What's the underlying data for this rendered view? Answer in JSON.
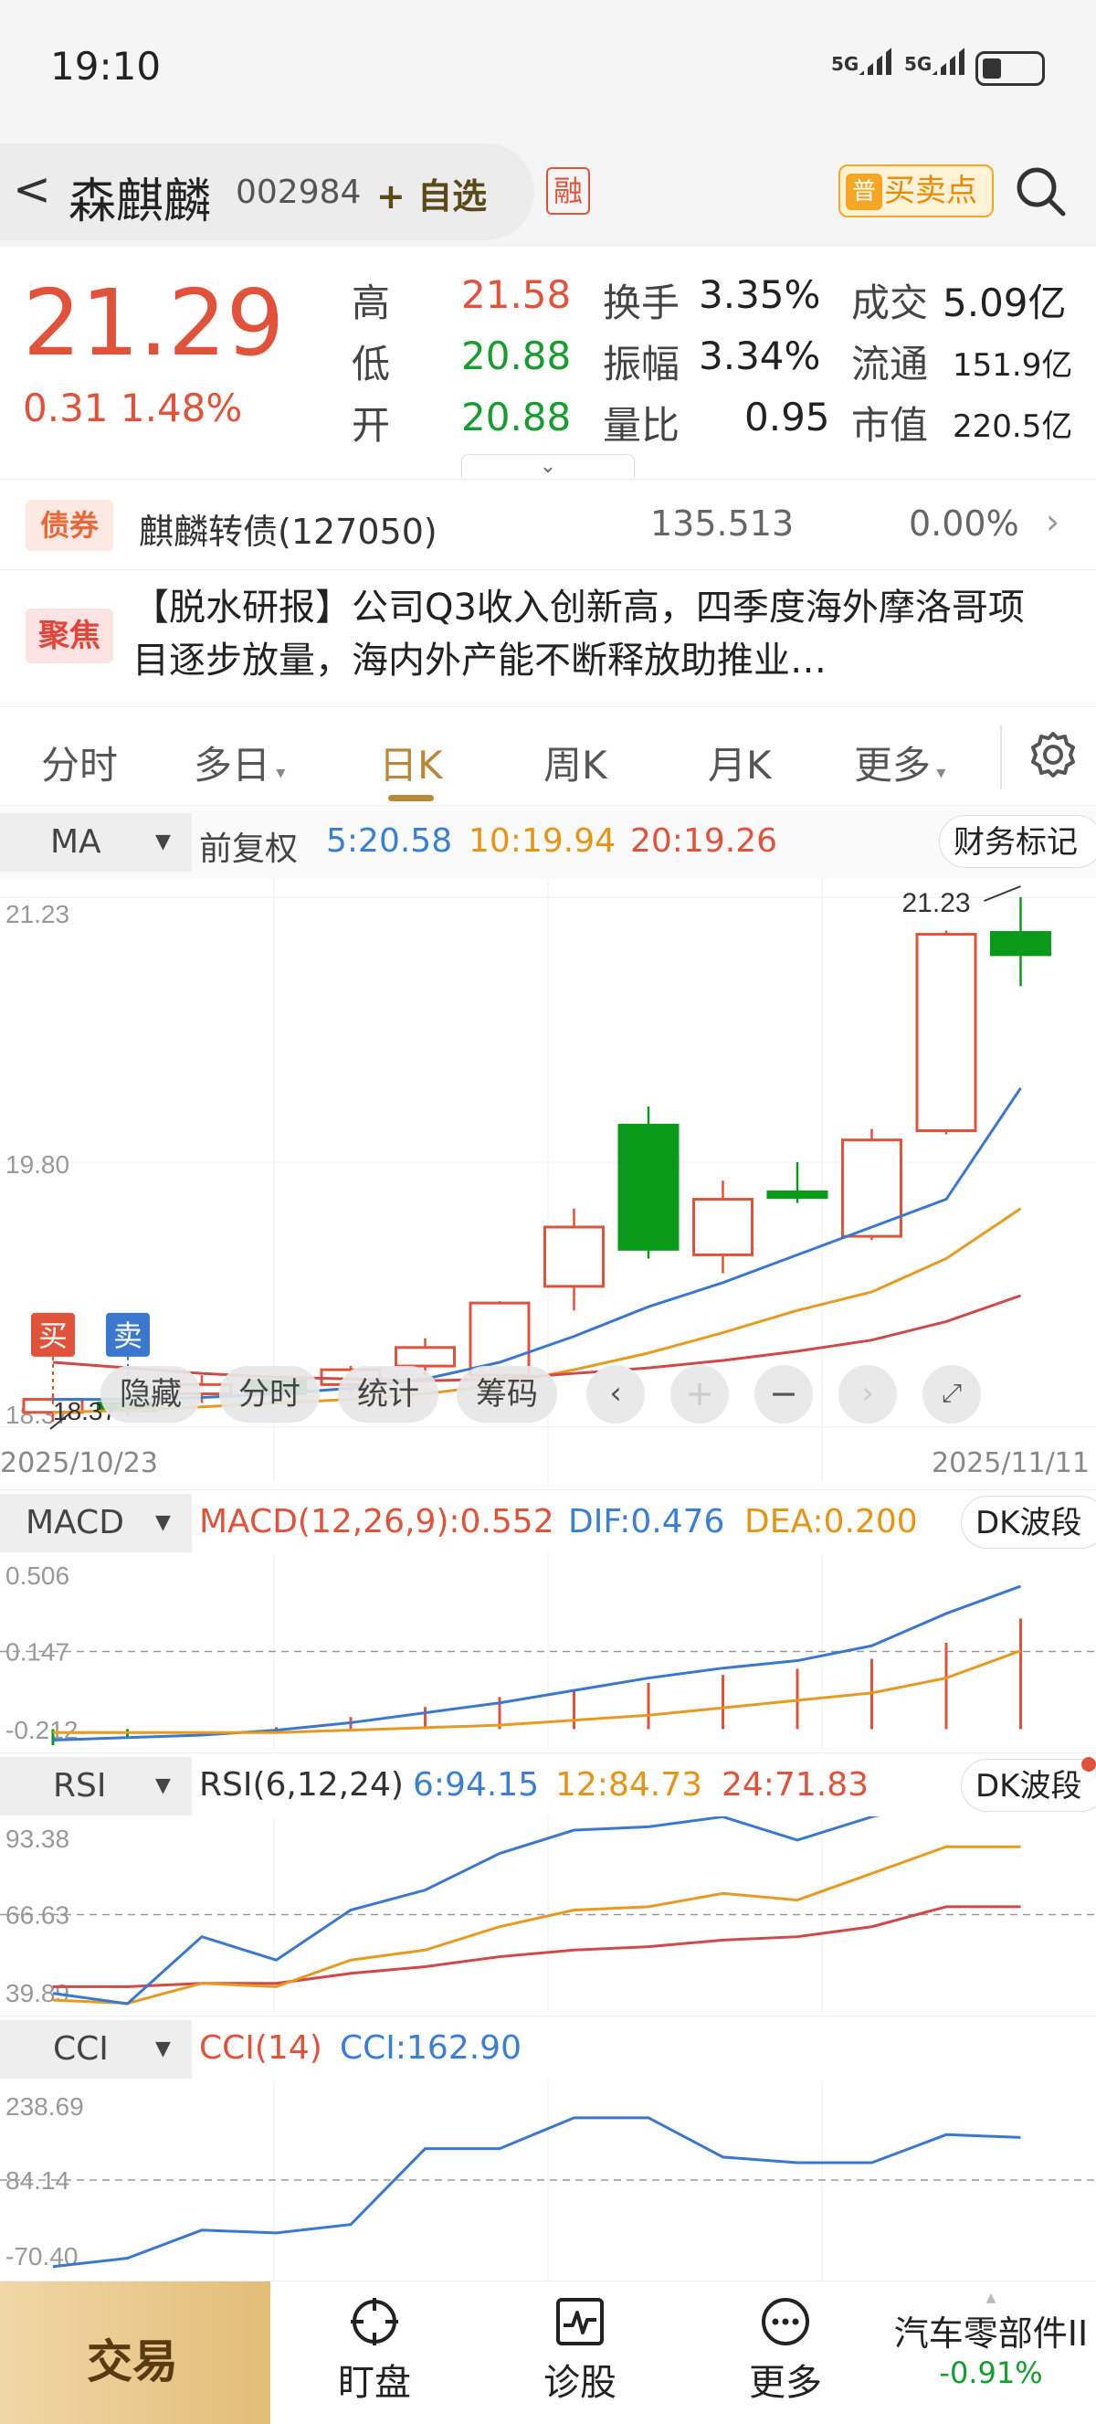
{
  "status": {
    "time": "19:10",
    "signal1": "5G",
    "signal2": "5G"
  },
  "header": {
    "back": "<",
    "name": "森麒麟",
    "code": "002984",
    "add_watch": "自选",
    "margin_badge": "融",
    "buy_sell_points": "买卖点",
    "pu_badge": "普"
  },
  "quote": {
    "price": "21.29",
    "change": "0.31",
    "change_pct": "1.48%",
    "high_label": "高",
    "high": "21.58",
    "low_label": "低",
    "low": "20.88",
    "open_label": "开",
    "open": "20.88",
    "turnover_label": "换手",
    "turnover": "3.35%",
    "amplitude_label": "振幅",
    "amplitude": "3.34%",
    "vol_ratio_label": "量比",
    "vol_ratio": "0.95",
    "deal_label": "成交",
    "deal": "5.09亿",
    "float_label": "流通",
    "float": "151.9亿",
    "mcap_label": "市值",
    "mcap": "220.5亿"
  },
  "bond": {
    "badge": "债券",
    "name": "麒麟转债(127050)",
    "price": "135.513",
    "change": "0.00%"
  },
  "focus": {
    "badge": "聚焦",
    "text": "【脱水研报】公司Q3收入创新高，四季度海外摩洛哥项目逐步放量，海内外产能不断释放助推业…"
  },
  "tabs": [
    "分时",
    "多日",
    "日K",
    "周K",
    "月K",
    "更多"
  ],
  "active_tab": "日K",
  "ma": {
    "selector": "MA",
    "adjust": "前复权",
    "ma5": "5:20.58",
    "ma10": "10:19.94",
    "ma20": "20:19.26",
    "fin_mark": "财务标记"
  },
  "chart_data": [
    {
      "type": "candlestick",
      "ylim": [
        18.37,
        21.23
      ],
      "x_start": "2025/10/23",
      "x_end": "2025/11/11",
      "y_labels": [
        "21.23",
        "19.80",
        "18.37"
      ],
      "max_label": "21.23",
      "min_label": "18.37",
      "candles": [
        {
          "o": 18.45,
          "c": 18.52,
          "h": 18.55,
          "l": 18.4,
          "up": true
        },
        {
          "o": 18.5,
          "c": 18.46,
          "h": 18.52,
          "l": 18.43,
          "up": false
        },
        {
          "o": 18.55,
          "c": 18.6,
          "h": 18.65,
          "l": 18.5,
          "up": true
        },
        {
          "o": 18.62,
          "c": 18.55,
          "h": 18.64,
          "l": 18.52,
          "up": false
        },
        {
          "o": 18.6,
          "c": 18.68,
          "h": 18.7,
          "l": 18.55,
          "up": true
        },
        {
          "o": 18.7,
          "c": 18.8,
          "h": 18.85,
          "l": 18.65,
          "up": true
        },
        {
          "o": 18.65,
          "c": 19.04,
          "h": 19.05,
          "l": 18.62,
          "up": true
        },
        {
          "o": 19.13,
          "c": 19.45,
          "h": 19.55,
          "l": 19.0,
          "up": true
        },
        {
          "o": 20.0,
          "c": 19.33,
          "h": 20.1,
          "l": 19.28,
          "up": false
        },
        {
          "o": 19.3,
          "c": 19.6,
          "h": 19.7,
          "l": 19.2,
          "up": true
        },
        {
          "o": 19.64,
          "c": 19.61,
          "h": 19.8,
          "l": 19.58,
          "up": false
        },
        {
          "o": 19.4,
          "c": 19.92,
          "h": 19.98,
          "l": 19.38,
          "up": true
        },
        {
          "o": 19.97,
          "c": 21.03,
          "h": 21.05,
          "l": 19.95,
          "up": true
        },
        {
          "o": 21.04,
          "c": 20.92,
          "h": 21.23,
          "l": 20.75,
          "up": false
        }
      ],
      "ma5": [
        18.52,
        18.52,
        18.53,
        18.55,
        18.58,
        18.63,
        18.72,
        18.86,
        19.02,
        19.15,
        19.3,
        19.45,
        19.6,
        20.2
      ],
      "ma10": [
        18.45,
        18.46,
        18.48,
        18.5,
        18.52,
        18.55,
        18.6,
        18.68,
        18.77,
        18.88,
        19.0,
        19.1,
        19.28,
        19.55
      ],
      "ma20": [
        18.72,
        18.69,
        18.66,
        18.64,
        18.63,
        18.62,
        18.63,
        18.66,
        18.69,
        18.73,
        18.78,
        18.84,
        18.94,
        19.08
      ],
      "signals": [
        {
          "label": "买"
        },
        {
          "label": "卖"
        }
      ]
    },
    {
      "type": "macd",
      "label": "MACD",
      "params": "MACD(12,26,9):0.552",
      "dif": "DIF:0.476",
      "dea": "DEA:0.200",
      "y_labels": [
        "0.506",
        "0.147",
        "-0.212"
      ],
      "hist": [
        -0.08,
        -0.04,
        0,
        0.01,
        0.06,
        0.11,
        0.16,
        0.2,
        0.23,
        0.27,
        0.3,
        0.35,
        0.43,
        0.55
      ],
      "dif_line": [
        -0.21,
        -0.2,
        -0.19,
        -0.17,
        -0.14,
        -0.1,
        -0.06,
        -0.01,
        0.04,
        0.08,
        0.11,
        0.17,
        0.3,
        0.41
      ],
      "dea_line": [
        -0.18,
        -0.18,
        -0.18,
        -0.18,
        -0.17,
        -0.16,
        -0.15,
        -0.13,
        -0.11,
        -0.08,
        -0.05,
        -0.02,
        0.04,
        0.15
      ],
      "btn": "DK波段"
    },
    {
      "type": "rsi",
      "label": "RSI",
      "params": "RSI(6,12,24)",
      "r6": "6:94.15",
      "r12": "12:84.73",
      "r24": "24:71.83",
      "y_labels": [
        "93.38",
        "66.63",
        "39.89"
      ],
      "rsi6": [
        43,
        39,
        60,
        53,
        68,
        74,
        85,
        92,
        93,
        96,
        89,
        96,
        101,
        100
      ],
      "rsi12": [
        41,
        40,
        46,
        45,
        53,
        56,
        63,
        68,
        69,
        73,
        71,
        79,
        87,
        87
      ],
      "rsi24": [
        45,
        45,
        46,
        46,
        49,
        51,
        54,
        56,
        57,
        59,
        60,
        63,
        69,
        69
      ],
      "btn": "DK波段"
    },
    {
      "type": "cci",
      "label": "CCI",
      "params": "CCI(14)",
      "value": "CCI:162.90",
      "y_labels": [
        "238.69",
        "84.14",
        "-70.40"
      ],
      "cci": [
        -70,
        -55,
        -5,
        -10,
        5,
        140,
        140,
        195,
        195,
        125,
        115,
        115,
        165,
        160
      ]
    }
  ],
  "toolbar": {
    "hide": "隐藏",
    "intraday": "分时",
    "stats": "统计",
    "chips": "筹码"
  },
  "bottom": {
    "trade": "交易",
    "watch": "盯盘",
    "diagnose": "诊股",
    "more": "更多",
    "sector": "汽车零部件II",
    "sector_pct": "-0.91%"
  },
  "colors": {
    "up": "#e0533a",
    "down": "#0a9a1a",
    "ma5": "#3a78d0",
    "ma10": "#e89a20",
    "ma20": "#d04848"
  }
}
